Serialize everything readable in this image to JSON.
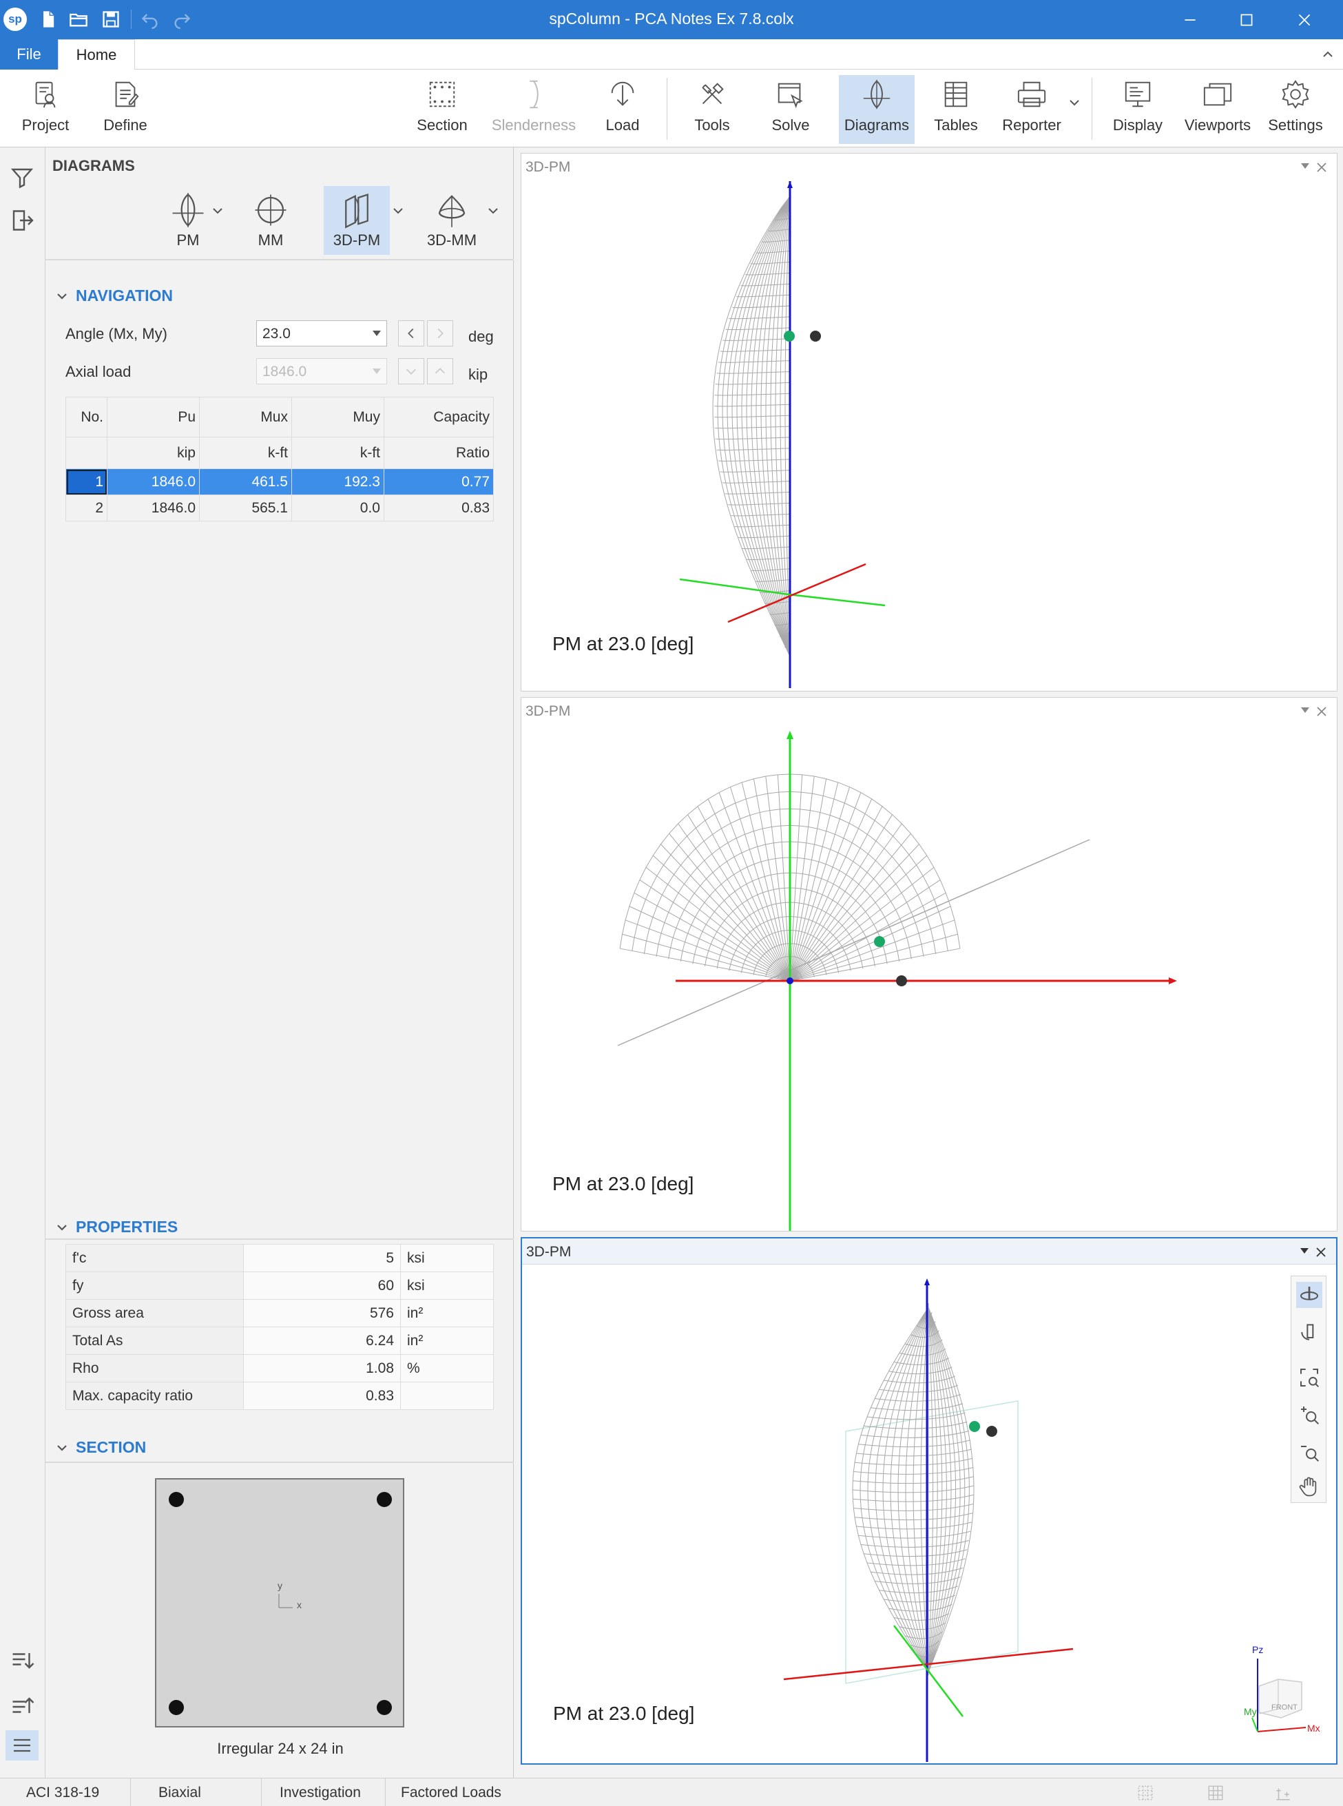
{
  "titlebar": {
    "title": "spColumn - PCA Notes Ex 7.8.colx",
    "logo": "sp"
  },
  "ribbon_tabs": {
    "file": "File",
    "home": "Home"
  },
  "ribbon": {
    "project": "Project",
    "define": "Define",
    "section": "Section",
    "slenderness": "Slenderness",
    "load": "Load",
    "tools": "Tools",
    "solve": "Solve",
    "diagrams": "Diagrams",
    "tables": "Tables",
    "reporter": "Reporter",
    "display": "Display",
    "viewports": "Viewports",
    "settings": "Settings"
  },
  "diagrams": {
    "header": "DIAGRAMS",
    "buttons": {
      "pm": "PM",
      "mm": "MM",
      "pm3d": "3D-PM",
      "mm3d": "3D-MM"
    }
  },
  "navigation": {
    "header": "NAVIGATION",
    "angle_label": "Angle (Mx, My)",
    "angle_value": "23.0",
    "angle_unit": "deg",
    "axial_label": "Axial load",
    "axial_value": "1846.0",
    "axial_unit": "kip"
  },
  "load_table": {
    "headers": [
      "No.",
      "Pu",
      "Mux",
      "Muy",
      "Capacity"
    ],
    "units": [
      "",
      "kip",
      "k-ft",
      "k-ft",
      "Ratio"
    ],
    "rows": [
      [
        "1",
        "1846.0",
        "461.5",
        "192.3",
        "0.77"
      ],
      [
        "2",
        "1846.0",
        "565.1",
        "0.0",
        "0.83"
      ]
    ],
    "selected_row": 0
  },
  "properties": {
    "header": "PROPERTIES",
    "rows": [
      {
        "name": "f'c",
        "value": "5",
        "unit": "ksi"
      },
      {
        "name": "fy",
        "value": "60",
        "unit": "ksi"
      },
      {
        "name": "Gross area",
        "value": "576",
        "unit": "in²"
      },
      {
        "name": "Total As",
        "value": "6.24",
        "unit": "in²"
      },
      {
        "name": "Rho",
        "value": "1.08",
        "unit": "%"
      },
      {
        "name": "Max. capacity ratio",
        "value": "0.83",
        "unit": ""
      }
    ]
  },
  "section": {
    "header": "SECTION",
    "axis_x": "x",
    "axis_y": "y",
    "caption": "Irregular 24 x 24 in"
  },
  "viewports": [
    {
      "title": "3D-PM",
      "caption": "PM at 23.0 [deg]"
    },
    {
      "title": "3D-PM",
      "caption": "PM at 23.0 [deg]"
    },
    {
      "title": "3D-PM",
      "caption": "PM at 23.0 [deg]"
    }
  ],
  "viewcube": {
    "face": "FRONT",
    "pz": "Pz",
    "mx": "Mx",
    "my": "My"
  },
  "statusbar": {
    "code": "ACI 318-19",
    "mode": "Biaxial",
    "run": "Investigation",
    "loads": "Factored Loads"
  },
  "colors": {
    "accent": "#2b79d0",
    "axis_red": "#e01515",
    "axis_green": "#22dd22",
    "axis_blue": "#1515cc",
    "point_green": "#1aa866",
    "point_dark": "#333333",
    "mesh": "#a8a8a8"
  }
}
